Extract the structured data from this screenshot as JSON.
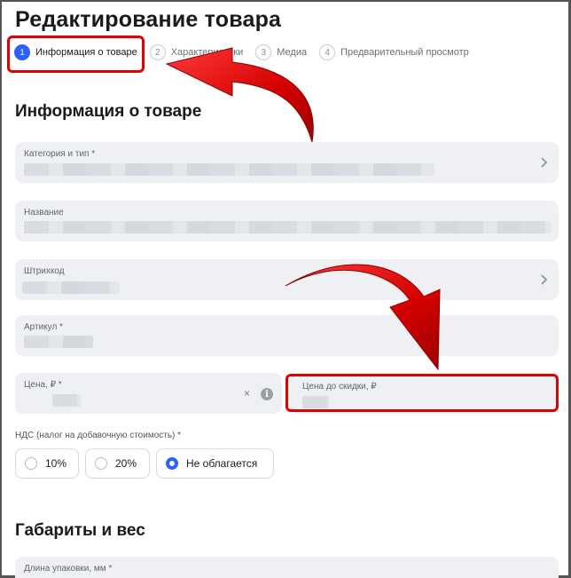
{
  "page": {
    "title": "Редактирование товара"
  },
  "steps": [
    {
      "num": "1",
      "label": "Информация о товаре",
      "active": true
    },
    {
      "num": "2",
      "label": "Характеристики",
      "active": false
    },
    {
      "num": "3",
      "label": "Медиа",
      "active": false
    },
    {
      "num": "4",
      "label": "Предварительный просмотр",
      "active": false
    }
  ],
  "sections": {
    "info": "Информация о товаре",
    "dimensions": "Габариты и вес"
  },
  "fields": {
    "category": {
      "label": "Категория и тип *"
    },
    "name": {
      "label": "Название"
    },
    "barcode": {
      "label": "Штрихкод"
    },
    "article": {
      "label": "Артикул *"
    },
    "price": {
      "label": "Цена, ₽ *",
      "clear_glyph": "×",
      "info_glyph": "i"
    },
    "price_before_discount": {
      "label": "Цена до скидки, ₽"
    },
    "package_length": {
      "label": "Длина упаковки, мм *"
    }
  },
  "vat": {
    "label": "НДС (налог на добавочную стоимость) *",
    "options": [
      {
        "label": "10%",
        "checked": false
      },
      {
        "label": "20%",
        "checked": false
      },
      {
        "label": "Не облагается",
        "checked": true
      }
    ]
  },
  "colors": {
    "accent": "#2b62ff",
    "field_bg": "#eef0f4",
    "highlight": "#e10000"
  }
}
